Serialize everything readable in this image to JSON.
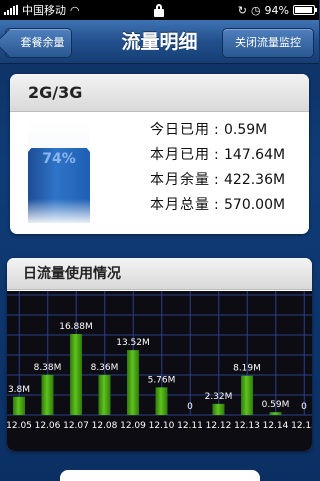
{
  "status_bar": {
    "carrier": "中国移动",
    "battery_text": "94%",
    "battery_level": 0.94
  },
  "nav": {
    "back_label": "套餐余量",
    "title": "流量明细",
    "right_label": "关闭流量监控"
  },
  "summary": {
    "header": "2G/3G",
    "percent_text": "74%",
    "percent_value": 0.74,
    "rows": [
      {
        "label": "今日已用",
        "value": "0.59M"
      },
      {
        "label": "本月已用",
        "value": "147.64M"
      },
      {
        "label": "本月余量",
        "value": "422.36M"
      },
      {
        "label": "本月总量",
        "value": "570.00M"
      }
    ]
  },
  "daily": {
    "header": "日流量使用情况"
  },
  "chart_data": {
    "type": "bar",
    "categories": [
      "12.05",
      "12.06",
      "12.07",
      "12.08",
      "12.09",
      "12.10",
      "12.11",
      "12.12",
      "12.13",
      "12.14",
      "12.15"
    ],
    "values": [
      3.8,
      8.38,
      16.88,
      8.36,
      13.52,
      5.76,
      0,
      2.32,
      8.19,
      0.59,
      0
    ],
    "data_labels": [
      "3.8M",
      "8.38M",
      "16.88M",
      "8.36M",
      "13.52M",
      "5.76M",
      "0",
      "2.32M",
      "8.19M",
      "0.59M",
      "0"
    ],
    "ylim": [
      0,
      20
    ],
    "grid": true,
    "colors": {
      "bar": "#5fc21c",
      "grid": "#2a3f8a",
      "background": "#0c0c12",
      "text": "#ffffff"
    }
  }
}
